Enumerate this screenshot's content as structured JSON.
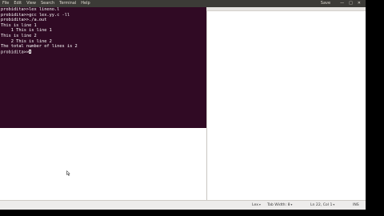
{
  "menubar": {
    "items": [
      "File",
      "Edit",
      "View",
      "Search",
      "Terminal",
      "Help"
    ],
    "save_label": "Save",
    "controls": {
      "minimize": "—",
      "restore": "□",
      "close": "✕"
    }
  },
  "terminal": {
    "lines": [
      "probidita>>lex lineno.l",
      "probidita>>gcc lex.yy.c -ll",
      "probidita>>./a.out",
      "This is line 1",
      "    1 This is line 1",
      "This is line 2",
      "    2 This is line 2",
      "The total number of lines is 2",
      "probidita>>"
    ]
  },
  "statusbar": {
    "language": "Lex",
    "tab_width": "Tab Width: 8",
    "position": "Ln 22, Col 1",
    "mode": "INS"
  },
  "colors": {
    "terminal_bg": "#300a24",
    "menubar_bg": "#3c3b37"
  }
}
